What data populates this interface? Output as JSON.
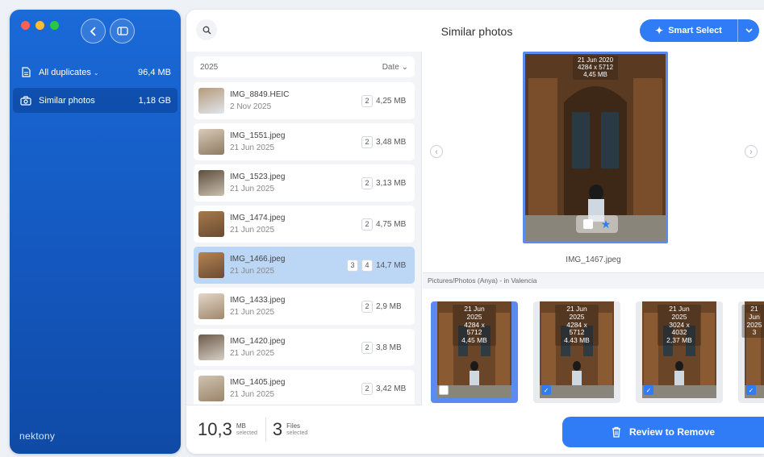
{
  "sidebar": {
    "items": [
      {
        "label": "All duplicates",
        "size": "96,4 MB",
        "icon": "document-icon"
      },
      {
        "label": "Similar photos",
        "size": "1,18 GB",
        "icon": "camera-icon"
      }
    ],
    "brand": "nektony"
  },
  "header": {
    "title": "Similar photos",
    "smart_select_label": "Smart Select"
  },
  "list": {
    "group": "2025",
    "sort_label": "Date",
    "rows": [
      {
        "name": "IMG_8849.HEIC",
        "date": "2 Nov 2025",
        "counts": [
          "2"
        ],
        "size": "4,25 MB"
      },
      {
        "name": "IMG_1551.jpeg",
        "date": "21 Jun 2025",
        "counts": [
          "2"
        ],
        "size": "3,48 MB"
      },
      {
        "name": "IMG_1523.jpeg",
        "date": "21 Jun 2025",
        "counts": [
          "2"
        ],
        "size": "3,13 MB"
      },
      {
        "name": "IMG_1474.jpeg",
        "date": "21 Jun 2025",
        "counts": [
          "2"
        ],
        "size": "4,75 MB"
      },
      {
        "name": "IMG_1466.jpeg",
        "date": "21 Jun 2025",
        "counts": [
          "3",
          "4"
        ],
        "size": "14,7 MB"
      },
      {
        "name": "IMG_1433.jpeg",
        "date": "21 Jun 2025",
        "counts": [
          "2"
        ],
        "size": "2,9 MB"
      },
      {
        "name": "IMG_1420.jpeg",
        "date": "21 Jun 2025",
        "counts": [
          "2"
        ],
        "size": "3,8 MB"
      },
      {
        "name": "IMG_1405.jpeg",
        "date": "21 Jun 2025",
        "counts": [
          "2"
        ],
        "size": "3,42 MB"
      }
    ]
  },
  "footer": {
    "size_value": "10,3",
    "size_unit": "MB",
    "size_caption": "selected",
    "files_value": "3",
    "files_unit": "Files",
    "files_caption": "selected"
  },
  "preview": {
    "date": "21 Jun 2020",
    "dimensions": "4284 x 5712",
    "size": "4,45 MB",
    "filename": "IMG_1467.jpeg",
    "path": "Pictures/Photos (Anya) - in Valencia"
  },
  "gallery": [
    {
      "date": "21 Jun 2025",
      "dimensions": "4284 x 5712",
      "size": "4,45 MB",
      "checked": false,
      "selected": true
    },
    {
      "date": "21 Jun 2025",
      "dimensions": "4284 x 5712",
      "size": "4.43 MB",
      "checked": true,
      "selected": false
    },
    {
      "date": "21 Jun 2025",
      "dimensions": "3024 x 4032",
      "size": "2,37 MB",
      "checked": true,
      "selected": false
    },
    {
      "date": "21 Jun 2025",
      "dimensions": "3",
      "size": "",
      "checked": true,
      "selected": false
    }
  ],
  "actions": {
    "review_label": "Review to Remove"
  },
  "colors": {
    "accent": "#2f7cf6",
    "sidebar": "#1458bf",
    "selected_row": "#bcd6f5"
  }
}
